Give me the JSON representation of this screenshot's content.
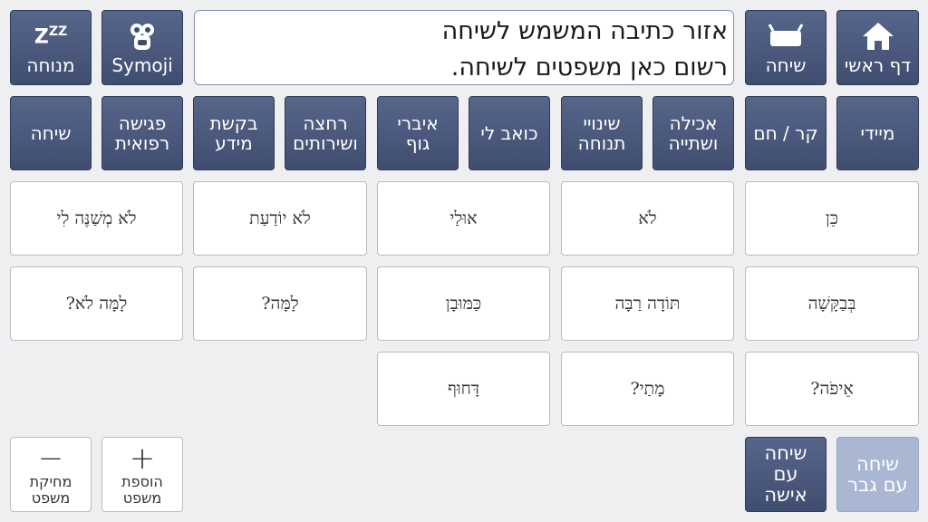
{
  "toolbar": {
    "home_label": "דף ראשי",
    "conversation_label": "שיחה",
    "symoji_label": "Symoji",
    "rest_label": "מנוחה"
  },
  "text_area": {
    "line1": "אזור כתיבה המשמש לשיחה",
    "line2": "רשום כאן משפטים לשיחה."
  },
  "categories": [
    "מיידי",
    "קר / חם",
    "אכילה\nושתייה",
    "שינויי\nתנוחה",
    "כואב לי",
    "איברי\nגוף",
    "רחצה\nושירותים",
    "בקשת\nמידע",
    "פגישה\nרפואית",
    "שיחה"
  ],
  "phrases": {
    "r1": [
      "כֵּן",
      "לֹא",
      "אוּלַי",
      "לֹא יוֹדַעַת",
      "לֹא מְשַׁנֶּה לִי"
    ],
    "r2": [
      "בְּבַקָּשָׁה",
      "תּוֹדָה רַבָּה",
      "כַּמּוּבָן",
      "לָמָּה?",
      "לָמָּה לֹא?"
    ],
    "r3": [
      "אֵיפֹה?",
      "מָתַי?",
      "דָּחוּף"
    ]
  },
  "bottom": {
    "talk_to_man": "שיחה\nעם גבר",
    "talk_to_woman": "שיחה\nעם\nאישה",
    "add_sentence": "הוספת\nמשפט",
    "delete_sentence": "מחיקת\nמשפט",
    "add_symbol": "+",
    "delete_symbol": "−"
  }
}
